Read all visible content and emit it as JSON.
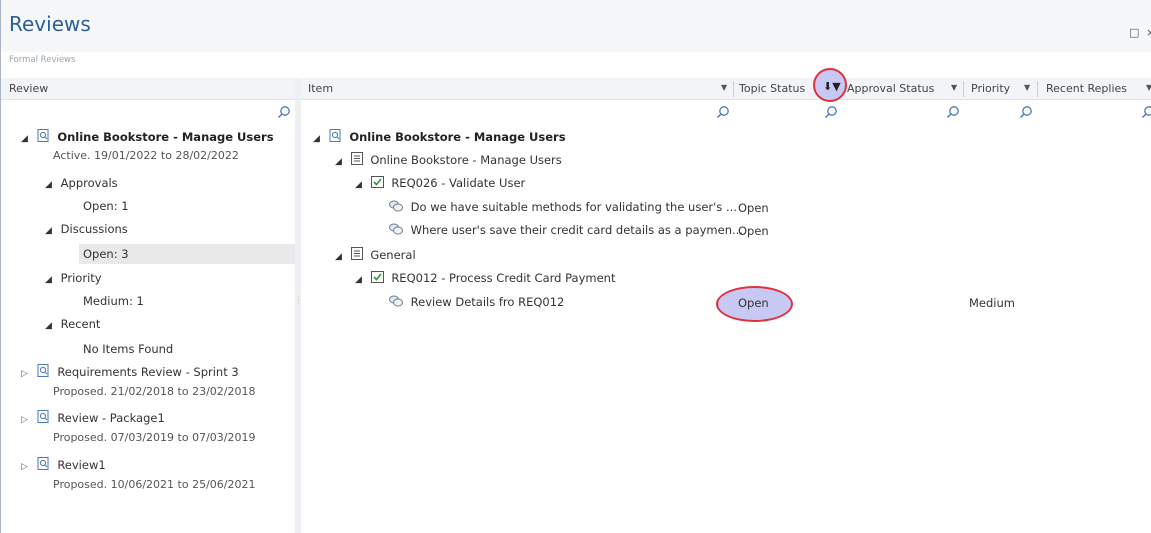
{
  "window": {
    "title": "Reviews",
    "subtitle": "Formal Reviews",
    "maximize_glyph": "□",
    "close_glyph": "×"
  },
  "left_panel": {
    "header": "Review",
    "tree": [
      {
        "label": "Online Bookstore - Manage Users",
        "detail": "Active.  19/01/2022  to 28/02/2022"
      },
      {
        "label": "Approvals"
      },
      {
        "label": "Open: 1"
      },
      {
        "label": "Discussions"
      },
      {
        "label": "Open: 3"
      },
      {
        "label": "Priority"
      },
      {
        "label": "Medium: 1"
      },
      {
        "label": "Recent"
      },
      {
        "label": "No Items Found"
      },
      {
        "label": "Requirements Review - Sprint 3",
        "detail": "Proposed.  21/02/2018  to 23/02/2018"
      },
      {
        "label": "Review - Package1",
        "detail": "Proposed.  07/03/2019  to 07/03/2019"
      },
      {
        "label": "Review1",
        "detail": "Proposed.  10/06/2021  to 25/06/2021"
      }
    ]
  },
  "right_panel": {
    "columns": [
      "Item",
      "Topic Status",
      "Approval Status",
      "Priority",
      "Recent Replies"
    ],
    "tree": [
      {
        "label": "Online Bookstore - Manage Users"
      },
      {
        "label": "Online Bookstore - Manage Users"
      },
      {
        "label": "REQ026 - Validate User"
      },
      {
        "label": "Do we have suitable methods for validating the user's ...",
        "status": "Open"
      },
      {
        "label": "Where user's save their credit card details as a paymen...",
        "status": "Open"
      },
      {
        "label": "General"
      },
      {
        "label": "REQ012 - Process Credit Card Payment"
      },
      {
        "label": "Review Details fro REQ012",
        "status": "Open",
        "priority": "Medium"
      }
    ]
  },
  "colors": {
    "title": "#2b5f96",
    "highlight_ring": "#e0313b",
    "highlight_fill": "#c8c8f4"
  }
}
